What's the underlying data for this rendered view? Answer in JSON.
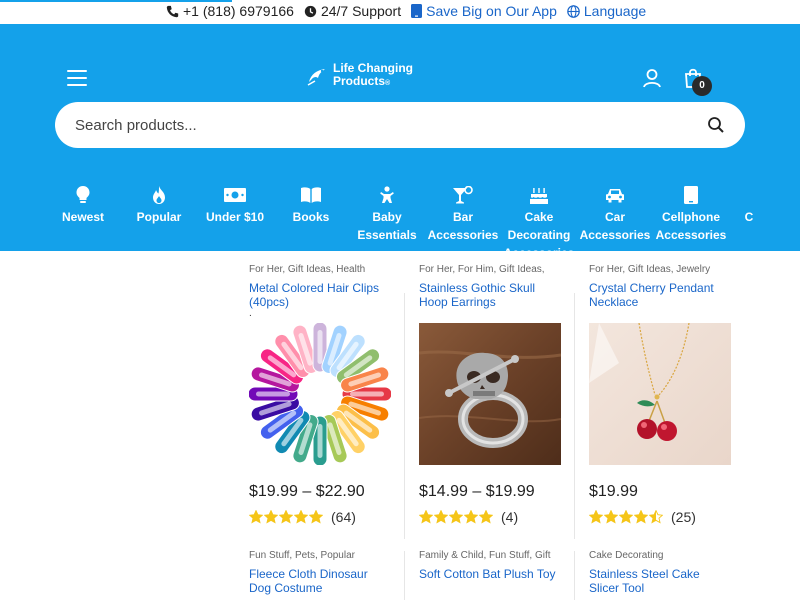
{
  "topbar": {
    "progress_fraction": 0.29,
    "phone": "+1 (818) 6979166",
    "support": "24/7 Support",
    "app_promo": "Save Big on Our App",
    "language": "Language"
  },
  "header": {
    "logo_line1": "Life Changing",
    "logo_line2": "Products",
    "cart_count": "0"
  },
  "search": {
    "placeholder": "Search products..."
  },
  "categories": [
    {
      "label": "Newest",
      "icon": "lightbulb-icon"
    },
    {
      "label": "Popular",
      "icon": "flame-icon"
    },
    {
      "label": "Under $10",
      "icon": "money-icon"
    },
    {
      "label": "Books",
      "icon": "book-icon"
    },
    {
      "label": "Baby\nEssentials",
      "icon": "baby-icon"
    },
    {
      "label": "Bar\nAccessories",
      "icon": "cocktail-icon"
    },
    {
      "label": "Cake\nDecorating\nAccessories",
      "icon": "cake-icon"
    },
    {
      "label": "Car\nAccessories",
      "icon": "car-icon"
    },
    {
      "label": "Cellphone\nAccessories",
      "icon": "phone-icon"
    },
    {
      "label": "C",
      "icon": "partial-icon"
    }
  ],
  "products": [
    {
      "categories": "For Her, Gift Ideas, Health",
      "title": "Metal Colored Hair Clips (40pcs)",
      "note": ".",
      "price": "$19.99 – $22.90",
      "rating": 5,
      "reviews": "(64)",
      "image": "hair-clips-image"
    },
    {
      "categories": "For Her, For Him, Gift Ideas,",
      "title": "Stainless Gothic Skull Hoop Earrings",
      "note": "",
      "price": "$14.99 – $19.99",
      "rating": 5,
      "reviews": "(4)",
      "image": "skull-earring-image"
    },
    {
      "categories": "For Her, Gift Ideas, Jewelry",
      "title": "Crystal Cherry Pendant Necklace",
      "note": "",
      "price": "$19.99",
      "rating": 4.5,
      "reviews": "(25)",
      "image": "cherry-necklace-image"
    },
    {
      "categories": "Fun Stuff, Pets, Popular",
      "title": "Fleece Cloth Dinosaur Dog Costume"
    },
    {
      "categories": "Family & Child, Fun Stuff, Gift",
      "title": "Soft Cotton Bat Plush Toy"
    },
    {
      "categories": "Cake Decorating",
      "title": "Stainless Steel Cake Slicer Tool"
    }
  ],
  "colors": {
    "brand_blue": "#14a1ea",
    "link_blue": "#1a66c9",
    "star_yellow": "#f5c518"
  }
}
